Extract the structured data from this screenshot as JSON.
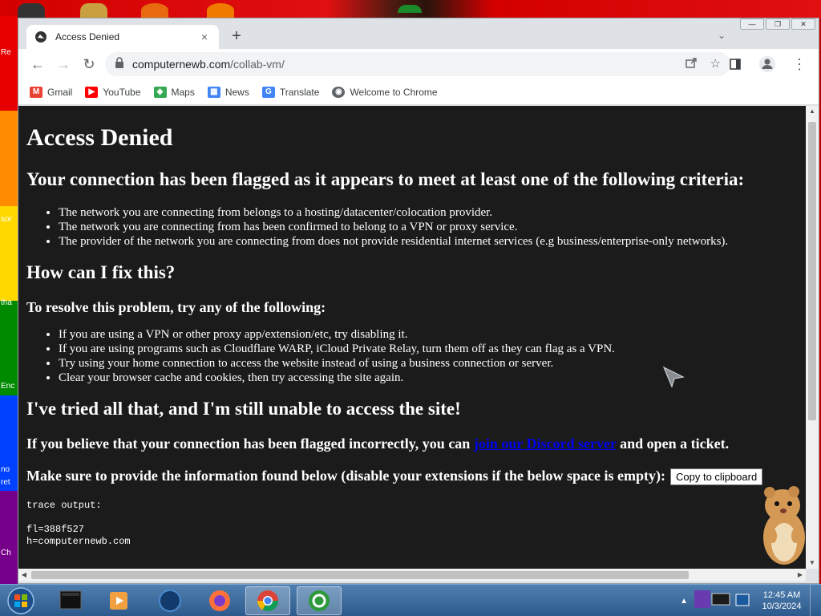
{
  "desktop": {
    "stripe_colors": [
      "#e60000",
      "#ff8c00",
      "#ffd800",
      "#008a00",
      "#0040ff",
      "#760089"
    ],
    "side_labels": [
      "Re",
      "sor",
      "tha",
      "Enc",
      "no",
      "ret",
      "Ch"
    ]
  },
  "browser": {
    "tab": {
      "title": "Access Denied",
      "close": "×"
    },
    "new_tab": "+",
    "window_controls": {
      "minimize": "—",
      "maximize": "❐",
      "close": "✕"
    },
    "nav": {
      "back": "←",
      "forward": "→",
      "reload": "↻"
    },
    "address": {
      "host": "computernewb.com",
      "path": "/collab-vm/"
    },
    "bookmarks": [
      {
        "label": "Gmail",
        "icon": "gmail-icon",
        "color": "#ea4335",
        "glyph": "M"
      },
      {
        "label": "YouTube",
        "icon": "youtube-icon",
        "color": "#ff0000",
        "glyph": "▶"
      },
      {
        "label": "Maps",
        "icon": "maps-icon",
        "color": "#34a853",
        "glyph": "◆"
      },
      {
        "label": "News",
        "icon": "news-icon",
        "color": "#4285f4",
        "glyph": "▦"
      },
      {
        "label": "Translate",
        "icon": "translate-icon",
        "color": "#4285f4",
        "glyph": "G"
      },
      {
        "label": "Welcome to Chrome",
        "icon": "chrome-icon",
        "color": "#5f6368",
        "glyph": "◉"
      }
    ]
  },
  "page": {
    "title": "Access Denied",
    "flag_heading": "Your connection has been flagged as it appears to meet at least one of the following criteria:",
    "criteria": [
      "The network you are connecting from belongs to a hosting/datacenter/colocation provider.",
      "The network you are connecting from has been confirmed to belong to a VPN or proxy service.",
      "The provider of the network you are connecting from does not provide residential internet services (e.g business/enterprise-only networks)."
    ],
    "fix_heading": "How can I fix this?",
    "resolve_heading": "To resolve this problem, try any of the following:",
    "fixes": [
      "If you are using a VPN or other proxy app/extension/etc, try disabling it.",
      "If you are using programs such as Cloudflare WARP, iCloud Private Relay, turn them off as they can flag as a VPN.",
      "Try using your home connection to access the website instead of using a business connection or server.",
      "Clear your browser cache and cookies, then try accessing the site again."
    ],
    "tried_heading": "I've tried all that, and I'm still unable to access the site!",
    "incorrect_prefix": "If you believe that your connection has been flagged incorrectly, you can ",
    "incorrect_link": "join our Discord server",
    "incorrect_suffix": " and open a ticket.",
    "info_text": "Make sure to provide the information found below (disable your extensions if the below space is empty):",
    "copy_button": "Copy to clipboard",
    "trace_label": "trace output:",
    "trace_lines": [
      "fl=388f527",
      "h=computernewb.com"
    ]
  },
  "taskbar": {
    "time": "12:45 AM",
    "date": "10/3/2024"
  }
}
